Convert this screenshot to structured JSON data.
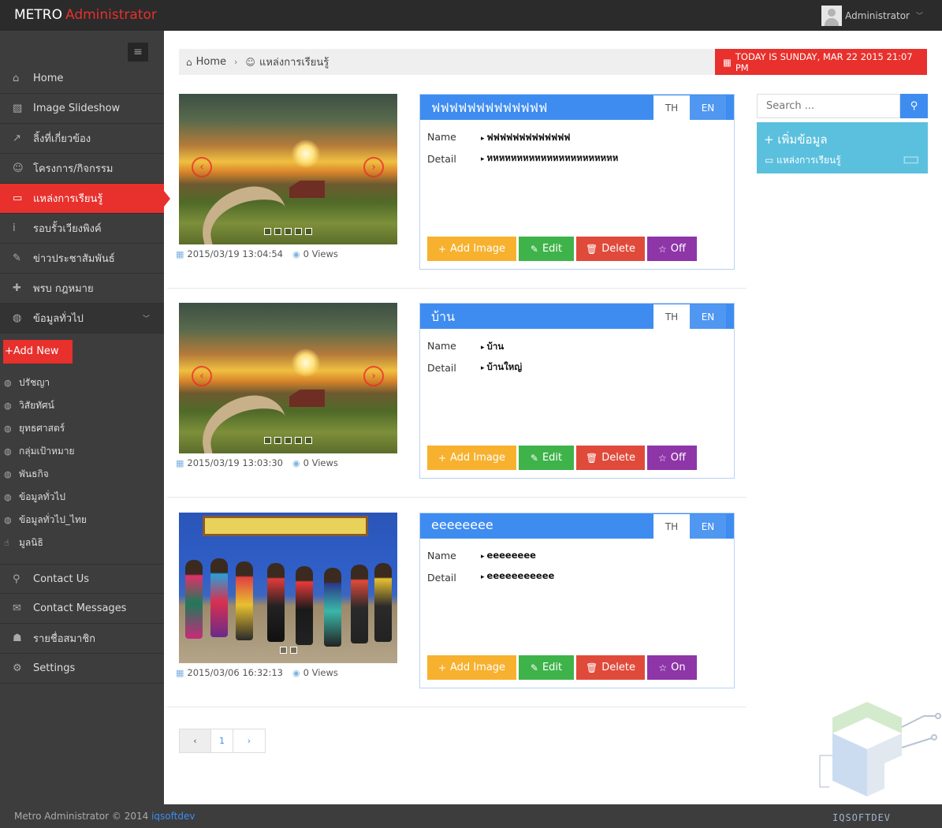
{
  "topbar": {
    "brand_main": "METRO",
    "brand_accent": "Administrator",
    "user": "Administrator"
  },
  "sidebar": {
    "items": [
      {
        "icon": "home-icon",
        "glyph": "⌂",
        "label": "Home"
      },
      {
        "icon": "image-icon",
        "glyph": "▨",
        "label": "Image Slideshow"
      },
      {
        "icon": "external-link-icon",
        "glyph": "↗",
        "label": "ลิ้งที่เกี่ยวข้อง"
      },
      {
        "icon": "smile-icon",
        "glyph": "☺",
        "label": "โครงการ/กิจกรรม"
      },
      {
        "icon": "laptop-icon",
        "glyph": "▭",
        "label": "แหล่งการเรียนรู้"
      },
      {
        "icon": "info-icon",
        "glyph": "i",
        "label": "รอบรั้วเวียงพิงค์"
      },
      {
        "icon": "bullhorn-icon",
        "glyph": "✎",
        "label": "ข่าวประชาสัมพันธ์"
      },
      {
        "icon": "gavel-icon",
        "glyph": "✚",
        "label": "พรบ กฎหมาย"
      },
      {
        "icon": "globe-icon",
        "glyph": "◍",
        "label": "ข้อมูลทั่วไป"
      }
    ],
    "add_new": "+Add New",
    "sub_items": [
      {
        "label": "ปรัชญา"
      },
      {
        "label": "วิสัยทัศน์"
      },
      {
        "label": "ยุทธศาสตร์"
      },
      {
        "label": "กลุ่มเป้าหมาย"
      },
      {
        "label": "พันธกิจ"
      },
      {
        "label": "ข้อมูลทั่วไป"
      },
      {
        "label": "ข้อมูลทั่วไป_ไทย"
      },
      {
        "label": "มูลนิธิ"
      }
    ],
    "items2": [
      {
        "icon": "map-marker-icon",
        "glyph": "⚲",
        "label": "Contact Us"
      },
      {
        "icon": "envelope-icon",
        "glyph": "✉",
        "label": "Contact Messages"
      },
      {
        "icon": "user-icon",
        "glyph": "☗",
        "label": "รายชื่อสมาชิก"
      },
      {
        "icon": "cogs-icon",
        "glyph": "⚙",
        "label": "Settings"
      }
    ]
  },
  "breadcrumb": {
    "home": "Home",
    "current": "แหล่งการเรียนรู้"
  },
  "date_banner": "TODAY IS SUNDAY, MAR 22 2015 21:07 PM",
  "entries": [
    {
      "title": "ฟฟฟฟฟฟฟฟฟฟฟฟฟ",
      "name": "ฟฟฟฟฟฟฟฟฟฟฟฟฟ",
      "detail": "หหหหหหหหหหหหหหหหหหหหหห",
      "date": "2015/03/19 13:04:54",
      "views": "0 Views",
      "toggle": "Off"
    },
    {
      "title": "บ้าน",
      "name": "บ้าน",
      "detail": "บ้านใหญ่",
      "date": "2015/03/19 13:03:30",
      "views": "0 Views",
      "toggle": "Off"
    },
    {
      "title": "eeeeeeee",
      "name": "eeeeeeee",
      "detail": "eeeeeeeeeee",
      "date": "2015/03/06 16:32:13",
      "views": "0 Views",
      "toggle": "On"
    }
  ],
  "card_labels": {
    "tab_th": "TH",
    "tab_en": "EN",
    "name": "Name",
    "detail": "Detail",
    "add_image": "Add Image",
    "edit": "Edit",
    "delete": "Delete"
  },
  "pager": {
    "page": "1"
  },
  "right": {
    "search_placeholder": "Search ...",
    "add_info": "เพิ่มข้อมูล",
    "add_info_sub": "แหล่งการเรียนรู้"
  },
  "footer": {
    "text": "Metro Administrator © 2014",
    "link": "iqsoftdev"
  },
  "logo": {
    "name": "IQSOFTDEV"
  },
  "colors": {
    "accent": "#e8302c",
    "primary": "#3e8cf0",
    "sidebar": "#3d3d3d"
  }
}
